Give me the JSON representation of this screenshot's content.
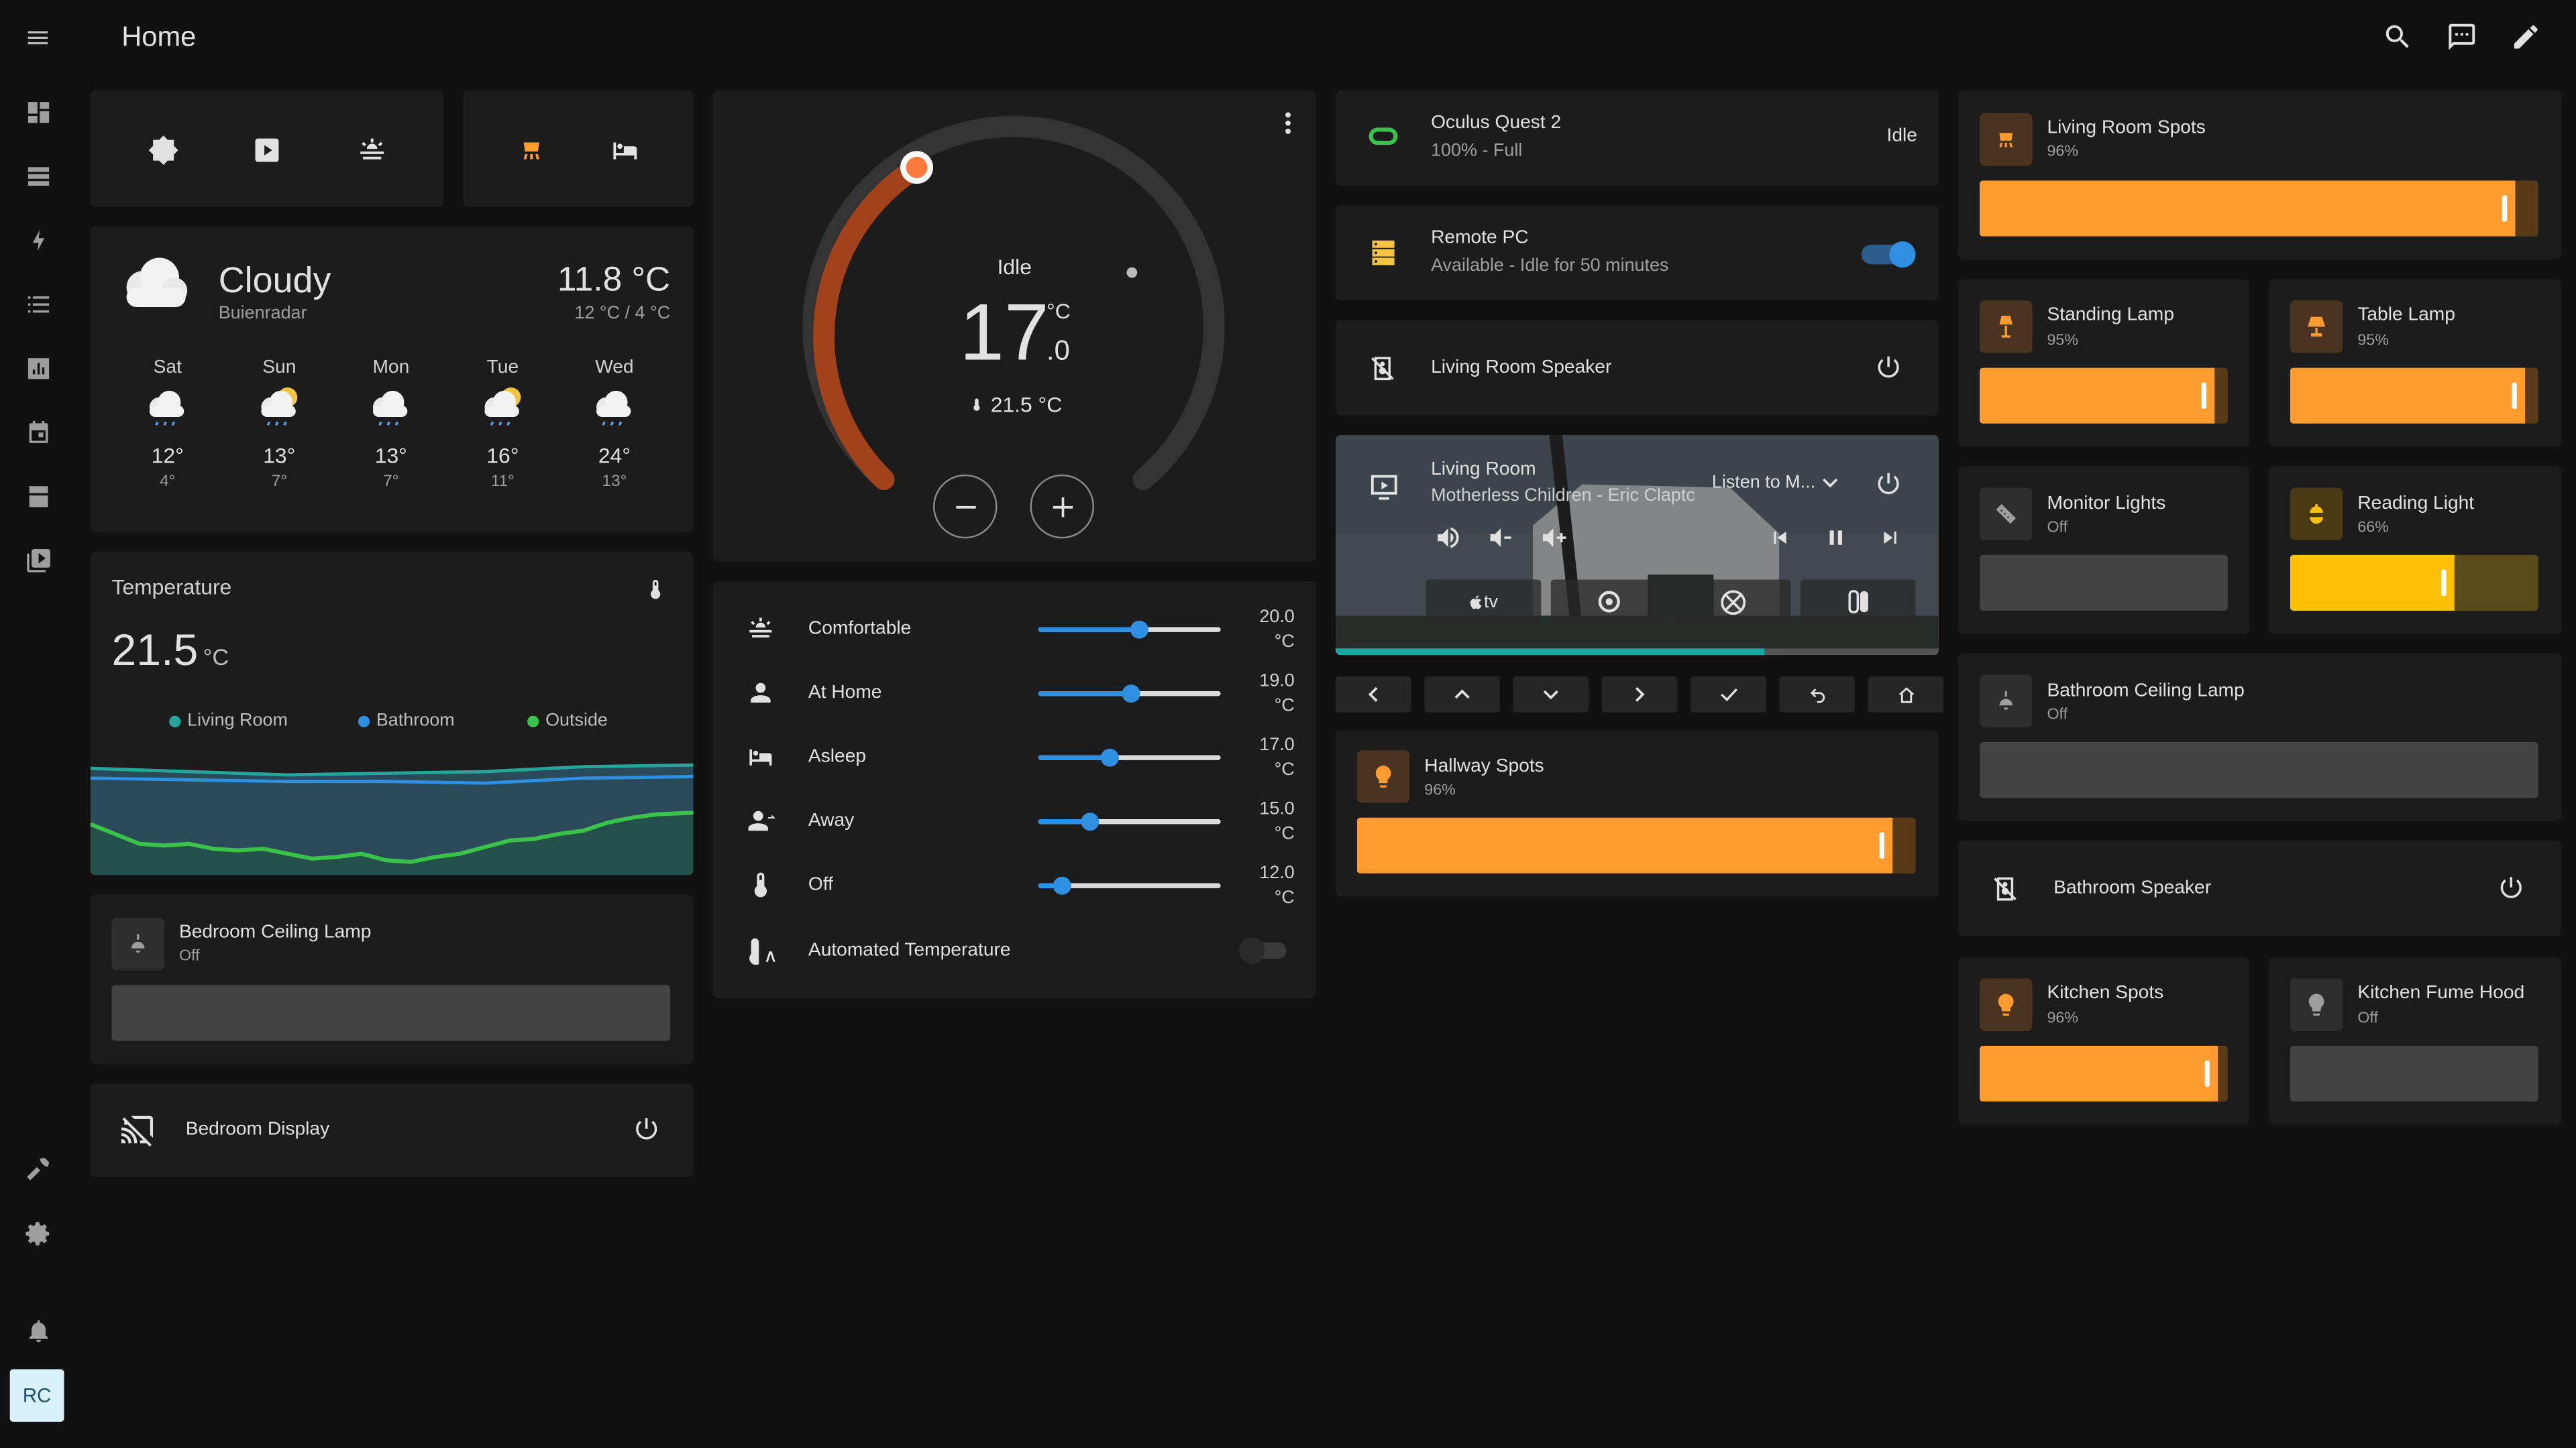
{
  "app": {
    "title": "Home",
    "user_initials": "RC"
  },
  "weather": {
    "condition": "Cloudy",
    "source": "Buienradar",
    "temp": "11.8 °C",
    "range": "12 °C / 4 °C",
    "forecast": [
      {
        "day": "Sat",
        "hi": "12°",
        "lo": "4°"
      },
      {
        "day": "Sun",
        "hi": "13°",
        "lo": "7°"
      },
      {
        "day": "Mon",
        "hi": "13°",
        "lo": "7°"
      },
      {
        "day": "Tue",
        "hi": "16°",
        "lo": "11°"
      },
      {
        "day": "Wed",
        "hi": "24°",
        "lo": "13°"
      }
    ]
  },
  "temperature_card": {
    "title": "Temperature",
    "value": "21.5",
    "unit": "°C",
    "legend": [
      "Living Room",
      "Bathroom",
      "Outside"
    ]
  },
  "bedroom_ceiling": {
    "name": "Bedroom Ceiling Lamp",
    "state": "Off"
  },
  "bedroom_display": {
    "name": "Bedroom Display"
  },
  "thermostat": {
    "mode": "Idle",
    "target_int": "17",
    "target_dec": ".0",
    "unit": "°C",
    "current": "21.5 °C"
  },
  "presets": [
    {
      "label": "Comfortable",
      "value": "20.0",
      "unit": "°C",
      "level": 0.55
    },
    {
      "label": "At Home",
      "value": "19.0",
      "unit": "°C",
      "level": 0.5
    },
    {
      "label": "Asleep",
      "value": "17.0",
      "unit": "°C",
      "level": 0.39
    },
    {
      "label": "Away",
      "value": "15.0",
      "unit": "°C",
      "level": 0.28
    },
    {
      "label": "Off",
      "value": "12.0",
      "unit": "°C",
      "level": 0.13
    }
  ],
  "automated": {
    "label": "Automated Temperature"
  },
  "oculus": {
    "name": "Oculus Quest 2",
    "detail": "100% - Full",
    "state": "Idle"
  },
  "remote_pc": {
    "name": "Remote PC",
    "detail": "Available - Idle for 50 minutes"
  },
  "living_speaker": {
    "name": "Living Room Speaker"
  },
  "media": {
    "name": "Living Room",
    "track": "Motherless Children - Eric Clapton",
    "source": "Listen to M...",
    "sources": [
      "tv"
    ],
    "progress": 0.71
  },
  "hallway": {
    "name": "Hallway Spots",
    "state": "96%",
    "level": 0.96
  },
  "lights": {
    "living_room_spots": {
      "name": "Living Room Spots",
      "state": "96%",
      "level": 0.96
    },
    "standing_lamp": {
      "name": "Standing Lamp",
      "state": "95%",
      "level": 0.95
    },
    "table_lamp": {
      "name": "Table Lamp",
      "state": "95%",
      "level": 0.95
    },
    "monitor_lights": {
      "name": "Monitor Lights",
      "state": "Off",
      "level": 0
    },
    "reading_light": {
      "name": "Reading Light",
      "state": "66%",
      "level": 0.66
    },
    "bathroom_ceiling": {
      "name": "Bathroom Ceiling Lamp",
      "state": "Off",
      "level": 0
    },
    "kitchen_spots": {
      "name": "Kitchen Spots",
      "state": "96%",
      "level": 0.96
    },
    "kitchen_hood": {
      "name": "Kitchen Fume Hood",
      "state": "Off",
      "level": 0
    }
  },
  "bathroom_speaker": {
    "name": "Bathroom Speaker"
  },
  "colors": {
    "accent": "#ff9b2f",
    "blue": "#2f8fe0",
    "reading": "#ffc107",
    "card": "#1c1c1c",
    "bg": "#111111"
  }
}
